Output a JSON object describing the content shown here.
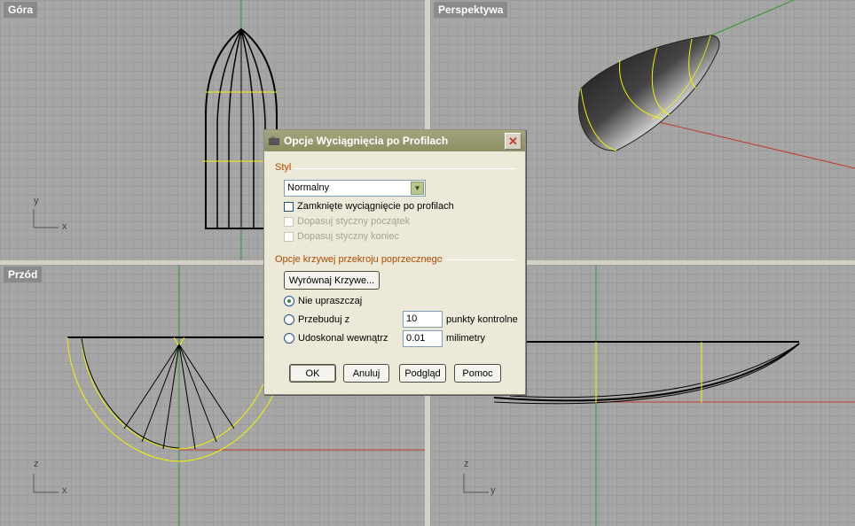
{
  "viewports": {
    "top": {
      "title": "Góra",
      "axis_v": "y",
      "axis_h": "x"
    },
    "perspective": {
      "title": "Perspektywa"
    },
    "front": {
      "title": "Przód",
      "axis_v": "z",
      "axis_h": "x"
    },
    "right": {
      "title": "",
      "axis_v": "z",
      "axis_h": "y"
    }
  },
  "dialog": {
    "title": "Opcje Wyciągnięcia po Profilach",
    "close_icon": "close-icon",
    "style_group": "Styl",
    "style_select": "Normalny",
    "closed_loft": "Zamknięte wyciągnięcie po profilach",
    "match_start": "Dopasuj styczny początek",
    "match_end": "Dopasuj styczny koniec",
    "cross_section_group": "Opcje krzywej przekroju poprzecznego",
    "align_curves_button": "Wyrównaj Krzywe...",
    "do_not_simplify": "Nie upraszczaj",
    "rebuild_with": "Przebuduj z",
    "rebuild_value": "10",
    "rebuild_unit": "punkty kontrolne",
    "refit_within": "Udoskonal wewnątrz",
    "refit_value": "0.01",
    "refit_unit": "milimetry",
    "ok": "OK",
    "cancel": "Anuluj",
    "preview": "Podgląd",
    "help": "Pomoc",
    "selected_rebuild_option": "do_not_simplify"
  },
  "colors": {
    "viewport_bg": "#a6a6a6",
    "grid": "#9b9b9b",
    "x_axis": "#c0392b",
    "y_axis": "#2e9b2e",
    "curve": "#000000",
    "highlight_curve": "#f2f200"
  }
}
